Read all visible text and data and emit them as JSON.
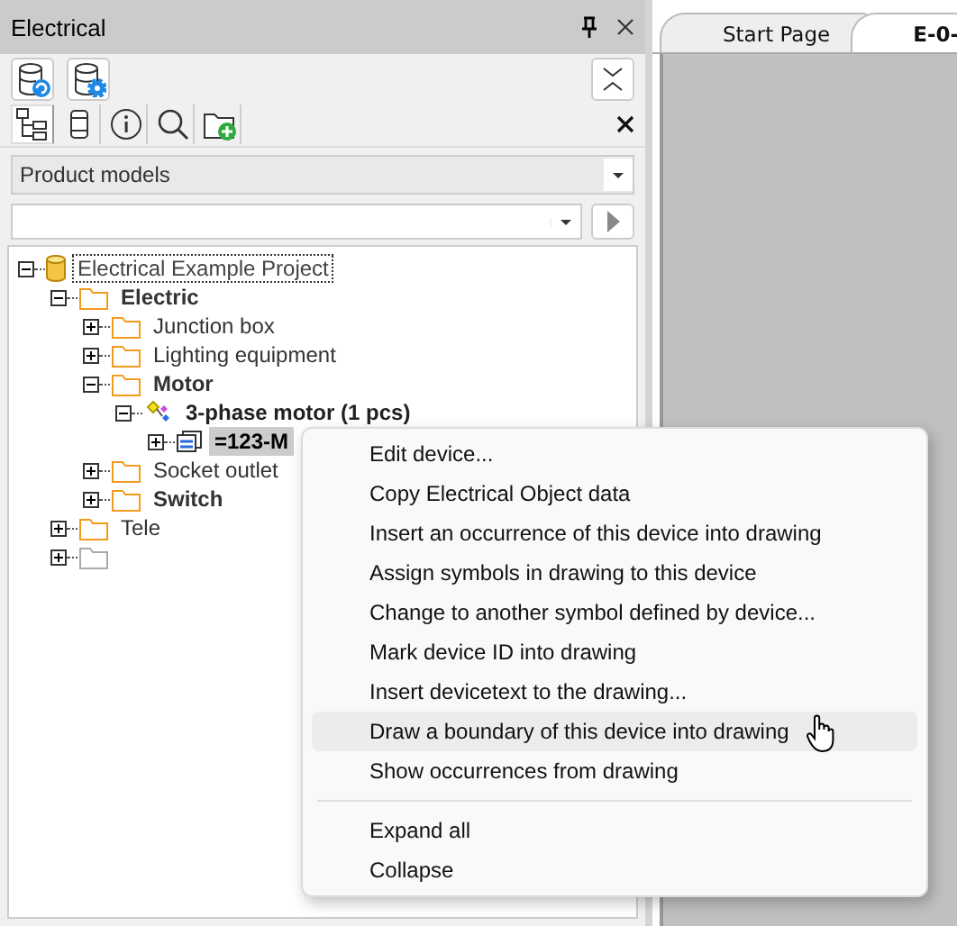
{
  "panel": {
    "title": "Electrical",
    "toolbar_top": [
      {
        "kind": "db-refresh"
      },
      {
        "kind": "db-settings"
      }
    ],
    "toolbar_tools": [
      {
        "kind": "tree",
        "selected": true
      },
      {
        "kind": "cylinder",
        "selected": false
      },
      {
        "kind": "info",
        "selected": false
      },
      {
        "kind": "search",
        "selected": false
      },
      {
        "kind": "folder-add",
        "selected": false
      }
    ],
    "view_select": {
      "value": "Product models"
    },
    "tree": [
      {
        "label": "Electrical Example Project",
        "kind": "project",
        "bold": false,
        "expanded": true,
        "selected": false,
        "focused": true,
        "children": [
          {
            "label": "Electric",
            "kind": "folder",
            "bold": true,
            "expanded": true,
            "selected": false,
            "focused": false,
            "children": [
              {
                "label": "Junction box",
                "kind": "folder",
                "bold": false,
                "expanded": false,
                "selected": false,
                "focused": false
              },
              {
                "label": "Lighting equipment",
                "kind": "folder",
                "bold": false,
                "expanded": false,
                "selected": false,
                "focused": false
              },
              {
                "label": "Motor",
                "kind": "folder",
                "bold": true,
                "expanded": true,
                "selected": false,
                "focused": false,
                "children": [
                  {
                    "label": "3-phase motor (1 pcs)",
                    "kind": "model",
                    "bold": true,
                    "expanded": true,
                    "selected": false,
                    "focused": false,
                    "children": [
                      {
                        "label": "=123-M",
                        "kind": "device",
                        "bold": true,
                        "expanded": false,
                        "selected": true,
                        "focused": false
                      }
                    ]
                  }
                ]
              },
              {
                "label": "Socket outlet",
                "kind": "folder",
                "bold": false,
                "expanded": false,
                "selected": false,
                "focused": false
              },
              {
                "label": "Switch",
                "kind": "folder",
                "bold": true,
                "expanded": false,
                "selected": false,
                "focused": false
              }
            ]
          },
          {
            "label": "Tele",
            "kind": "folder",
            "bold": false,
            "expanded": false,
            "selected": false,
            "focused": false
          },
          {
            "kind": "empty-folder",
            "expanded": false
          }
        ]
      }
    ]
  },
  "document_tabs": [
    {
      "label": "Start Page",
      "selected": false
    },
    {
      "label": "E-0-",
      "selected": true
    }
  ],
  "context_menu": {
    "groups": [
      [
        {
          "label": "Edit device...",
          "hovered": false
        },
        {
          "label": "Copy Electrical Object data",
          "hovered": false
        },
        {
          "label": "Insert an occurrence of this device into drawing",
          "hovered": false
        },
        {
          "label": "Assign symbols in drawing to this device",
          "hovered": false
        },
        {
          "label": "Change to another symbol defined by device...",
          "hovered": false
        },
        {
          "label": "Mark device ID into drawing",
          "hovered": false
        },
        {
          "label": "Insert devicetext to the drawing...",
          "hovered": false
        },
        {
          "label": "Draw a boundary of this device into drawing",
          "hovered": true
        },
        {
          "label": "Show occurrences from drawing",
          "hovered": false
        }
      ],
      [
        {
          "label": "Expand all",
          "hovered": false
        },
        {
          "label": "Collapse",
          "hovered": false
        }
      ]
    ]
  }
}
